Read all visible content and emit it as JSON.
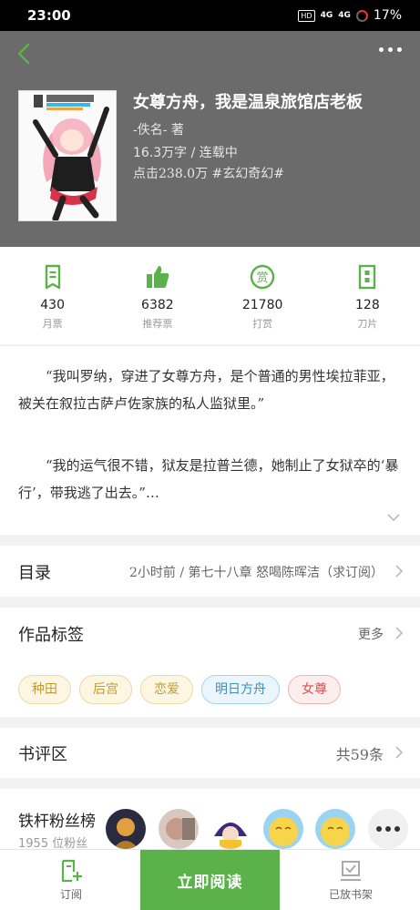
{
  "status_bar": {
    "time": "23:00",
    "hd": "HD",
    "signal1": "4G",
    "signal2": "4G",
    "battery": "17%"
  },
  "book": {
    "title": "女尊方舟，我是温泉旅馆店老板",
    "author_line": "-佚名-  著",
    "words_status": "16.3万字 / 连载中",
    "clicks_genre": "点击238.0万  #玄幻奇幻#"
  },
  "stats": [
    {
      "icon": "monthly-ticket-icon",
      "value": "430",
      "label": "月票"
    },
    {
      "icon": "thumbs-up-icon",
      "value": "6382",
      "label": "推荐票"
    },
    {
      "icon": "reward-icon",
      "value": "21780",
      "label": "打赏"
    },
    {
      "icon": "blade-icon",
      "value": "128",
      "label": "刀片"
    }
  ],
  "synopsis": {
    "p1": "“我叫罗纳，穿进了女尊方舟，是个普通的男性埃拉菲亚，被关在叙拉古萨卢佐家族的私人监狱里。”",
    "p2": "“我的运气很不错，狱友是拉普兰德，她制止了女狱卒的‘暴行’，带我逃了出去。”…"
  },
  "toc": {
    "title": "目录",
    "latest": "2小时前 / 第七十八章 怒喝陈晖洁（求订阅）"
  },
  "tags": {
    "title": "作品标签",
    "more": "更多",
    "items": [
      {
        "label": "种田",
        "color": "#c89a2a",
        "bg": "#fdf6e3",
        "border": "#edd9a6"
      },
      {
        "label": "后宫",
        "color": "#c89a2a",
        "bg": "#fdf6e3",
        "border": "#edd9a6"
      },
      {
        "label": "恋爱",
        "color": "#c89a2a",
        "bg": "#fdf6e3",
        "border": "#edd9a6"
      },
      {
        "label": "明日方舟",
        "color": "#3a8fc6",
        "bg": "#eaf5fc",
        "border": "#a9d3ee"
      },
      {
        "label": "女尊",
        "color": "#d45555",
        "bg": "#fdeeee",
        "border": "#f1b3b3"
      }
    ]
  },
  "reviews": {
    "title": "书评区",
    "count": "共59条"
  },
  "fans": {
    "title": "铁杆粉丝榜",
    "sub": "1955 位粉丝"
  },
  "bottom": {
    "subscribe": "订阅",
    "read": "立即阅读",
    "shelf": "已放书架"
  },
  "colors": {
    "accent": "#5bb24a",
    "header_bg": "#6b6b6b"
  }
}
